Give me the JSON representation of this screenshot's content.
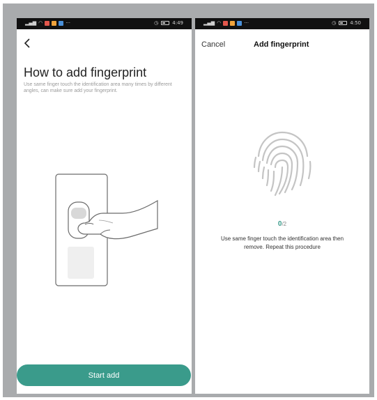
{
  "left_screen": {
    "status": {
      "time": "4:49",
      "more": "···"
    },
    "title": "How to add fingerprint",
    "subtitle": "Use same finger touch the identification area many times by different angles, can make sure add your fingerprint.",
    "start_button": "Start add",
    "icons": {
      "back": "back-arrow-icon"
    }
  },
  "right_screen": {
    "status": {
      "time": "4:50",
      "more": "···"
    },
    "cancel": "Cancel",
    "title": "Add fingerprint",
    "progress": {
      "current": "0",
      "total": "/2"
    },
    "instruction": "Use same finger touch the identification area then remove. Repeat this procedure"
  },
  "colors": {
    "accent": "#3a9b8b",
    "frame": "#a9abad",
    "status_bar": "#111111"
  }
}
